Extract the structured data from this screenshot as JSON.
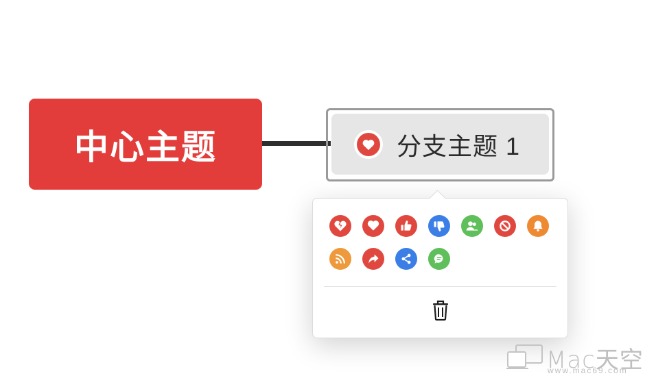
{
  "central_topic": {
    "label": "中心主题",
    "color": "#e23d3b"
  },
  "branch_topic": {
    "label": "分支主题 1",
    "marker": "heart-icon",
    "marker_color": "#e0483f"
  },
  "marker_picker": {
    "markers": [
      {
        "name": "broken-heart-icon",
        "color": "#e0483f"
      },
      {
        "name": "heart-icon",
        "color": "#e0483f"
      },
      {
        "name": "thumbs-up-icon",
        "color": "#e0483f"
      },
      {
        "name": "thumbs-down-icon",
        "color": "#3b7ee6"
      },
      {
        "name": "users-icon",
        "color": "#5fbf5a"
      },
      {
        "name": "prohibited-icon",
        "color": "#e0483f"
      },
      {
        "name": "bell-icon",
        "color": "#ee8a32"
      },
      {
        "name": "rss-icon",
        "color": "#ee9a3c"
      },
      {
        "name": "share-arrow-icon",
        "color": "#e0483f"
      },
      {
        "name": "share-icon",
        "color": "#3b7ee6"
      },
      {
        "name": "comment-icon",
        "color": "#5fbf5a"
      }
    ],
    "delete_icon": "trash-icon"
  },
  "watermark": {
    "name": "Mac天空",
    "url": "www.mac69.com"
  }
}
